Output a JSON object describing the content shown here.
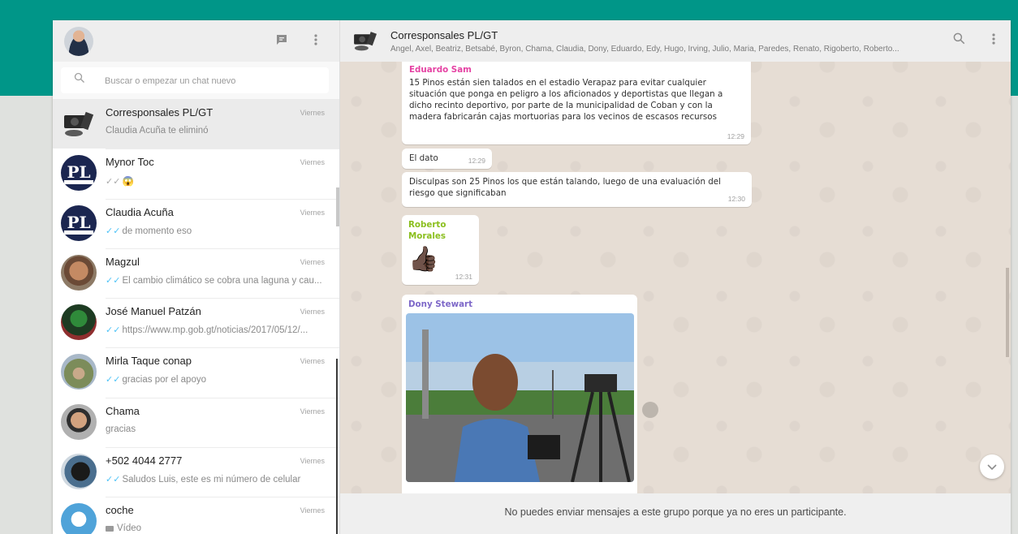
{
  "left": {
    "search": {
      "placeholder": "Buscar o empezar un chat nuevo"
    },
    "chats": [
      {
        "name": "Corresponsales PL/GT",
        "time": "Viernes",
        "last": "Claudia Acuña te eliminó",
        "ticks": ""
      },
      {
        "name": "Mynor Toc",
        "time": "Viernes",
        "last": "😱",
        "ticks": "✓✓"
      },
      {
        "name": "Claudia Acuña",
        "time": "Viernes",
        "last": "de momento eso",
        "ticks": "✓✓"
      },
      {
        "name": "Magzul",
        "time": "Viernes",
        "last": "El cambio climático se cobra una laguna y cau...",
        "ticks": "✓✓"
      },
      {
        "name": "José Manuel Patzán",
        "time": "Viernes",
        "last": "https://www.mp.gob.gt/noticias/2017/05/12/...",
        "ticks": "✓✓"
      },
      {
        "name": "Mirla Taque conap",
        "time": "Viernes",
        "last": "gracias por el apoyo",
        "ticks": "✓✓"
      },
      {
        "name": "Chama",
        "time": "Viernes",
        "last": "gracias",
        "ticks": ""
      },
      {
        "name": "+502 4044 2777",
        "time": "Viernes",
        "last": "Saludos Luis, este es mi número de celular",
        "ticks": "✓✓"
      },
      {
        "name": "coche",
        "time": "Viernes",
        "last": "Vídeo",
        "ticks": ""
      }
    ]
  },
  "conversation": {
    "title": "Corresponsales PL/GT",
    "members": "Ángel, Axel, Beatriz, Betsabé, Byron, Chama, Claudia, Dony, Eduardo, Edy, Hugo, Irving, Julio, Maria, Paredes, Renato, Rigoberto, Roberto...",
    "messages": [
      {
        "sender": "Eduardo Sam",
        "sender_color": "#e542a3",
        "text": "15 Pinos están sien talados en el estadio Verapaz para evitar cualquier situación que ponga en peligro a los aficionados y deportistas que llegan a dicho recinto deportivo, por parte de la municipalidad de Coban y con la madera fabricarán cajas mortuorias para los vecinos de escasos recursos",
        "time": "12:29"
      },
      {
        "text": "El dato",
        "time": "12:29"
      },
      {
        "text": "Disculpas son 25 Pinos los que están talando, luego de una evaluación del riesgo que significaban",
        "time": "12:30"
      },
      {
        "sender": "Roberto Morales",
        "sender_color": "#8bbf1f",
        "emoji": "👍🏿",
        "time": "12:31"
      },
      {
        "sender": "Dony Stewart",
        "sender_color": "#7d67c8"
      }
    ],
    "footer": "No puedes enviar mensajes a este grupo porque ya no eres un participante."
  },
  "colors": {
    "header_band": "#009688",
    "ticks": "#4fc3f7"
  }
}
